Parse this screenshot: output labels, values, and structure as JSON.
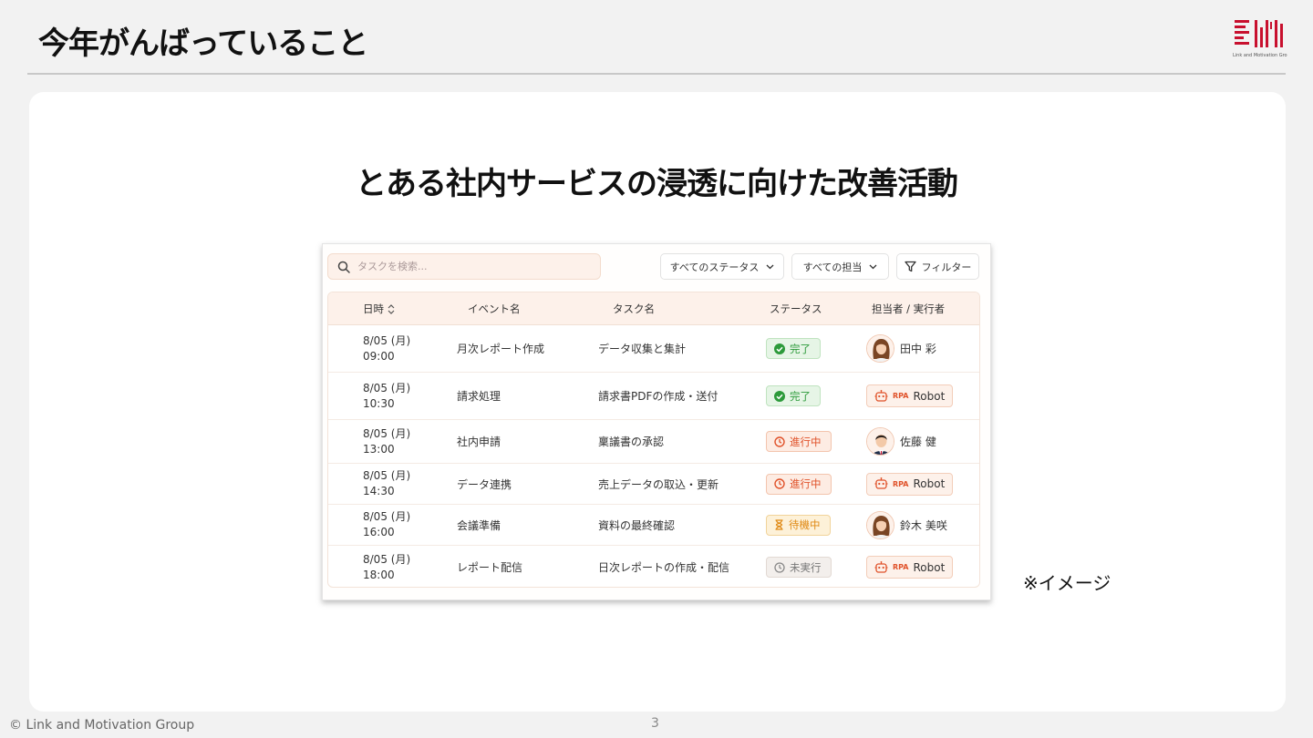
{
  "slide": {
    "title": "今年がんばっていること",
    "subtitle": "とある社内サービスの浸透に向けた改善活動",
    "note": "※イメージ",
    "copyright": "© Link and Motivation Group",
    "page_number": "3",
    "logo_caption": "Link and Motivation Group",
    "accent_color": "#c8102e"
  },
  "app": {
    "search": {
      "placeholder": "タスクを検索..."
    },
    "filters": {
      "status": "すべてのステータス",
      "assignee": "すべての担当",
      "filter": "フィルター"
    },
    "columns": {
      "date": "日時",
      "event": "イベント名",
      "task": "タスク名",
      "status": "ステータス",
      "assignee": "担当者 / 実行者"
    },
    "rows": [
      {
        "date": "8/05 (月)",
        "time": "09:00",
        "event": "月次レポート作成",
        "task": "データ収集と集計",
        "status": "完了",
        "status_type": "done",
        "assignee": "田中 彩",
        "assignee_type": "person",
        "avatar": "female"
      },
      {
        "date": "8/05 (月)",
        "time": "10:30",
        "event": "請求処理",
        "task": "請求書PDFの作成・送付",
        "status": "完了",
        "status_type": "done",
        "assignee": "Robot",
        "assignee_type": "robot",
        "rpa": "RPA"
      },
      {
        "date": "8/05 (月)",
        "time": "13:00",
        "event": "社内申請",
        "task": "稟議書の承認",
        "status": "進行中",
        "status_type": "progress",
        "assignee": "佐藤 健",
        "assignee_type": "person",
        "avatar": "male"
      },
      {
        "date": "8/05 (月)",
        "time": "14:30",
        "event": "データ連携",
        "task": "売上データの取込・更新",
        "status": "進行中",
        "status_type": "progress",
        "assignee": "Robot",
        "assignee_type": "robot",
        "rpa": "RPA"
      },
      {
        "date": "8/05 (月)",
        "time": "16:00",
        "event": "会議準備",
        "task": "資料の最終確認",
        "status": "待機中",
        "status_type": "waiting",
        "assignee": "鈴木 美咲",
        "assignee_type": "person",
        "avatar": "female"
      },
      {
        "date": "8/05 (月)",
        "time": "18:00",
        "event": "レポート配信",
        "task": "日次レポートの作成・配信",
        "status": "未実行",
        "status_type": "notrun",
        "assignee": "Robot",
        "assignee_type": "robot",
        "rpa": "RPA"
      }
    ],
    "status_colors": {
      "done": "#2c9a3a",
      "progress": "#e0522a",
      "waiting": "#e08a16",
      "notrun": "#777777"
    },
    "icons": {
      "search": "search-icon",
      "chevron": "chevron-down-icon",
      "filter": "filter-icon",
      "sort": "sort-icon",
      "done": "check-circle-icon",
      "progress": "clock-icon",
      "waiting": "hourglass-icon",
      "notrun": "clock-icon",
      "robot": "robot-icon"
    }
  }
}
